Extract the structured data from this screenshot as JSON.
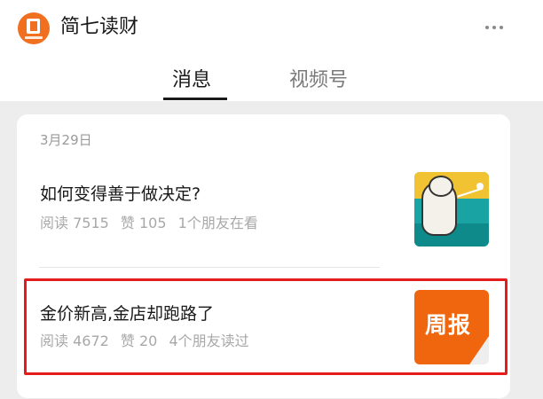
{
  "header": {
    "account_name": "简七读财",
    "tabs": [
      {
        "label": "消息",
        "active": true
      },
      {
        "label": "视频号",
        "active": false
      }
    ]
  },
  "feed": {
    "date": "3月29日",
    "articles": [
      {
        "title": "如何变得善于做决定?",
        "read": "阅读 7515",
        "likes": "赞 105",
        "friends": "1个朋友在看",
        "thumbnail": "polar-bear-illustration"
      },
      {
        "title": "金价新高,金店却跑路了",
        "read": "阅读 4672",
        "likes": "赞 20",
        "friends": "4个朋友读过",
        "thumbnail_text": "周报",
        "highlighted": true
      }
    ]
  },
  "colors": {
    "brand": "#f07020",
    "highlight": "#e51c1c",
    "badge": "#f0660e"
  }
}
